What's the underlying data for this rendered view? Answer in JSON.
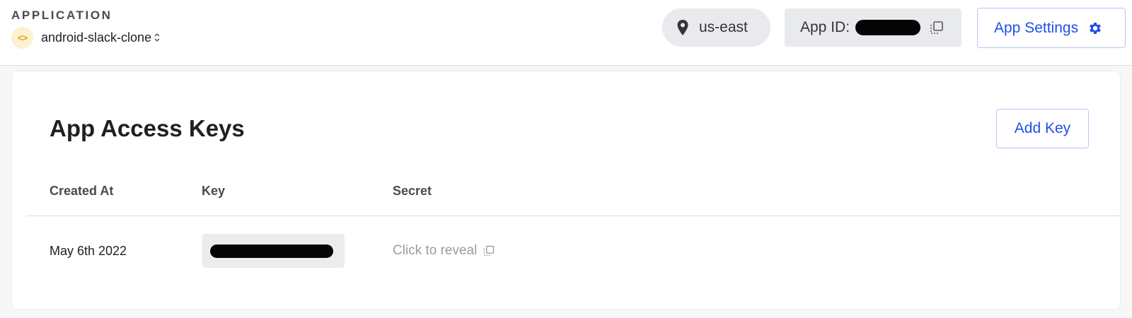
{
  "header": {
    "section_label": "APPLICATION",
    "app_name": "android-slack-clone",
    "app_icon": "code-icon",
    "region": "us-east",
    "app_id_label": "App ID:",
    "app_id_value": "redacted",
    "settings_label": "App Settings"
  },
  "main": {
    "title": "App Access Keys",
    "add_key_label": "Add Key",
    "columns": [
      "Created At",
      "Key",
      "Secret"
    ],
    "rows": [
      {
        "created_at": "May 6th 2022",
        "key": "redacted",
        "secret": "Click to reveal"
      }
    ]
  },
  "colors": {
    "accent": "#1f50e6",
    "icon_badge_bg": "#fdf1cf",
    "icon_badge_fg": "#d9a21f",
    "pill_bg": "#e9eaee"
  }
}
